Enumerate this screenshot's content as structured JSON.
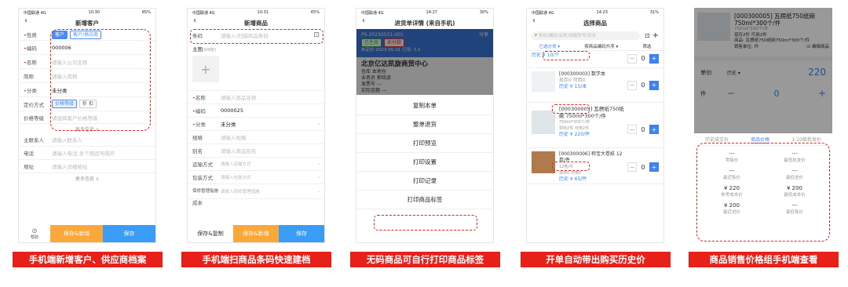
{
  "status": {
    "carrier": "中国联通 4G"
  },
  "p1": {
    "time": "10:30",
    "battery": "65%",
    "title": "新增客户",
    "type_label": "性质",
    "type_options": [
      "客户",
      "客户/供应商"
    ],
    "code_label": "编码",
    "code_value": "000006",
    "name_label": "名称",
    "name_ph": "请输入公司名称",
    "abbr_label": "简称",
    "abbr_ph": "请输入简称",
    "cat_label": "分类",
    "cat_value": "未分类",
    "price_method_label": "定价方式",
    "price_options": [
      "价格等级",
      "折 扣"
    ],
    "price_level_label": "价格等级",
    "price_level_ph": "请选择客户价格等级",
    "more1": "更多信息 ∨",
    "contact_label": "主联系人",
    "contact_ph": "请输入联系人",
    "phone_label": "电话",
    "phone_ph": "请输入电话,多个用逗号隔开",
    "addr_label": "地址",
    "addr_ph": "请输入详细地址",
    "more2": "更多信息 ∨",
    "help": "帮助",
    "save_new": "保存&新增",
    "save": "保存",
    "caption": "手机端新增客户、供应商档案"
  },
  "p2": {
    "time": "10:31",
    "battery": "65%",
    "title": "新增商品",
    "barcode_label": "条码",
    "barcode_ph": "请输入/扫描商品条码",
    "image_label": "主图",
    "image_count": "(0/9张)",
    "name_label": "名称",
    "name_ph": "请输入商品名称",
    "code_label": "编码",
    "code_value": "0000025",
    "cat_label": "分类",
    "cat_value": "未分类",
    "spec_label": "规格",
    "spec_ph": "请输入规格",
    "alias_label": "别名",
    "alias_ph": "请输入商品别名",
    "ship_label": "运输方式",
    "ship_ph": "请输入运输方式",
    "pack_label": "包装方式",
    "pack_ph": "请输入包装方式",
    "warranty_label": "保修管理指施",
    "warranty_ph": "请输入保修管理措施",
    "cut_label": "成本",
    "save_copy": "保存&复制",
    "save_new": "保存&新增",
    "save": "保存",
    "caption": "手机端扫商品条码快速建档"
  },
  "p3": {
    "time": "14:27",
    "battery": "30%",
    "title": "进货单详情 (来自手机)",
    "doc_no": "PS-20230531-001",
    "share": "分享",
    "badges": [
      "已生效",
      "未付款"
    ],
    "date_line": "未定价   2023-05-31   已用: 3.3",
    "supplier": "北京亿达凯旋商贸中心",
    "warehouse": "仓库  本地仓",
    "salesman": "业务员  郭晓波",
    "freight": "发票号  ---",
    "paid": "实际金额  ---",
    "menu": [
      "复制本单",
      "整单退货",
      "打印预览",
      "打印设置",
      "打印记录",
      "打印商品标签"
    ],
    "caption": "无码商品可自行打印商品标签"
  },
  "p4": {
    "time": "14:23",
    "battery": "31%",
    "title": "选择商品",
    "search_ph": "条码/编码/名称/规格型号/别名",
    "filters": [
      "已选分类 ▾",
      "按商品编码升序 ▾",
      "筛选"
    ],
    "items": [
      {
        "name": "",
        "stock": "",
        "price": "历史 ¥ 10/个",
        "qty": "0"
      },
      {
        "name": "[000300003] 数学本",
        "stock": "现存0   可用0",
        "price": "历史 ¥ 15/本",
        "qty": "0"
      },
      {
        "name": "[000300005] 瓦楞纸750纸碗 750ml*300个/件",
        "tag": "750ml*300个/件",
        "stock": "现存2件   可用2件",
        "price": "历史 ¥ 220/件",
        "qty": "0"
      },
      {
        "name": "[000300006] 称宝大卷纸 12卷/件",
        "tag": "12卷/件",
        "stock": "现存0   可用0",
        "price": "历史 ¥ 65/件",
        "qty": "0"
      }
    ],
    "caption": "开单自动带出购买历史价"
  },
  "p5": {
    "prod_name": "[000300005] 瓦楞纸750纸碗 750ml*300个/件",
    "tag": "750ml*300个/件",
    "stock": "现存2件   可用2件",
    "product": "商品: 瓦楞纸750纸碗750ml*300个/件",
    "unit": "销售单位: 件",
    "edit": "编辑商品",
    "price_label": "单价",
    "price_hint": "历史 ▾",
    "price_value": "220",
    "qty_label": "件",
    "qty_value": "0",
    "tabs": [
      "历史成交价",
      "商品价格",
      "1-10级批发价"
    ],
    "prices": [
      {
        "v": "---",
        "k": "零售价"
      },
      {
        "v": "---",
        "k": "最低批发价"
      },
      {
        "v": "---",
        "k": "最近售价"
      },
      {
        "v": "---",
        "k": "最低进价"
      },
      {
        "v": "¥ 220",
        "k": "参考成本价"
      },
      {
        "v": "¥ 200",
        "k": "最低成本价"
      },
      {
        "v": "¥ 200",
        "k": "最近进价"
      },
      {
        "v": "---",
        "k": "最低售价"
      }
    ],
    "caption": "商品销售价格组手机端查看"
  }
}
